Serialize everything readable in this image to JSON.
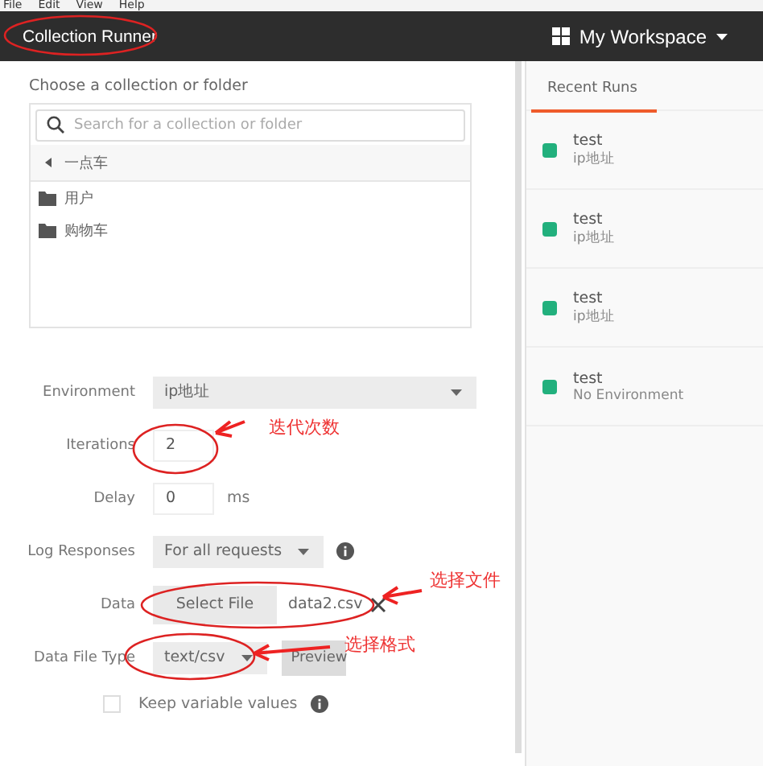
{
  "menu_bar": [
    "File",
    "Edit",
    "View",
    "Help"
  ],
  "header": {
    "title": "Collection Runner",
    "workspace": "My Workspace"
  },
  "collection_picker": {
    "label": "Choose a collection or folder",
    "search": {
      "placeholder": "Search for a collection or folder"
    },
    "breadcrumb": "一点车",
    "folders": [
      "用户",
      "购物车"
    ]
  },
  "form": {
    "environment": {
      "label": "Environment",
      "value": "ip地址"
    },
    "iterations": {
      "label": "Iterations",
      "value": "2"
    },
    "delay": {
      "label": "Delay",
      "value": "0",
      "unit": "ms"
    },
    "log_responses": {
      "label": "Log Responses",
      "value": "For all requests"
    },
    "data": {
      "label": "Data",
      "button": "Select File",
      "file": "data2.csv"
    },
    "data_file_type": {
      "label": "Data File Type",
      "value": "text/csv",
      "button": "Preview"
    },
    "keep_variable_values": {
      "label": "Keep variable values",
      "checked": false
    }
  },
  "recent_runs": {
    "tab": "Recent Runs",
    "runs": [
      {
        "name": "test",
        "environment": "ip地址",
        "color": "#22b07d"
      },
      {
        "name": "test",
        "environment": "ip地址",
        "color": "#22b07d"
      },
      {
        "name": "test",
        "environment": "ip地址",
        "color": "#22b07d"
      },
      {
        "name": "test",
        "environment": "No Environment",
        "color": "#22b07d"
      }
    ]
  },
  "annotations": [
    {
      "text": "迭代次数"
    },
    {
      "text": "选择文件"
    },
    {
      "text": "选择格式"
    }
  ]
}
